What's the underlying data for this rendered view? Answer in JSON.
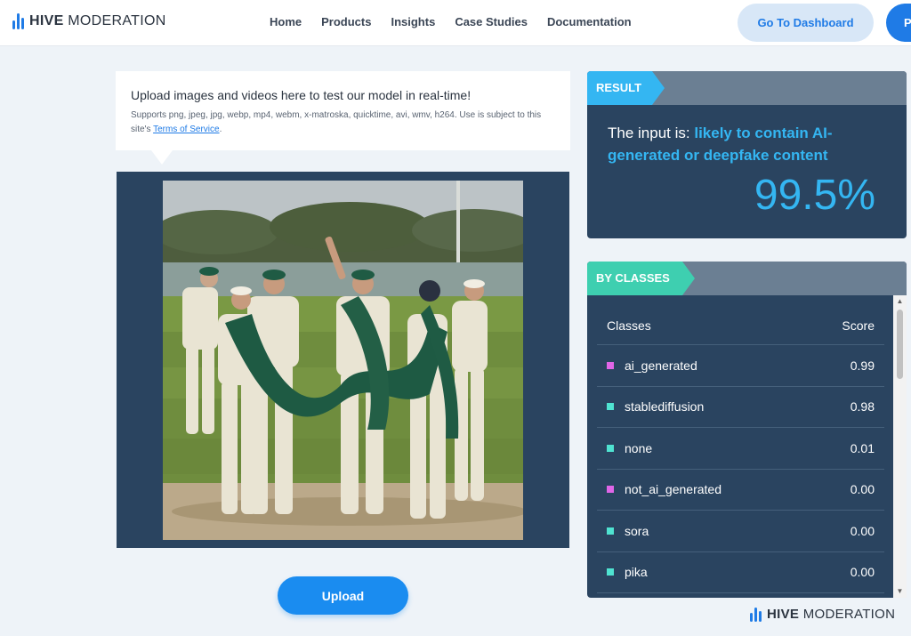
{
  "brand": {
    "bold": "HIVE",
    "light": "MODERATION"
  },
  "nav": [
    "Home",
    "Products",
    "Insights",
    "Case Studies",
    "Documentation"
  ],
  "header_buttons": {
    "dashboard": "Go To Dashboard",
    "cut_button": "P"
  },
  "upload_info": {
    "title": "Upload images and videos here to test our model in real-time!",
    "supports": "Supports png, jpeg, jpg, webp, mp4, webm, x-matroska, quicktime, avi, wmv, h264. Use is subject to this site's",
    "terms_link": "Terms of Service",
    "terms_end": "."
  },
  "upload_button": "Upload",
  "result": {
    "tag": "RESULT",
    "prefix": "The input is:",
    "verdict": "likely to contain AI-generated or deepfake content",
    "percent": "99.5%"
  },
  "classes": {
    "tag": "BY CLASSES",
    "header": {
      "name": "Classes",
      "score": "Score"
    },
    "rows": [
      {
        "name": "ai_generated",
        "score": "0.99",
        "color": "#e066e8"
      },
      {
        "name": "stablediffusion",
        "score": "0.98",
        "color": "#4fe3d1"
      },
      {
        "name": "none",
        "score": "0.01",
        "color": "#4fe3d1"
      },
      {
        "name": "not_ai_generated",
        "score": "0.00",
        "color": "#e066e8"
      },
      {
        "name": "sora",
        "score": "0.00",
        "color": "#4fe3d1"
      },
      {
        "name": "pika",
        "score": "0.00",
        "color": "#4fe3d1"
      }
    ]
  },
  "colors": {
    "accent": "#34b6f2",
    "panel": "#2a4460",
    "primary": "#1f7be6",
    "classes_tag": "#3ecfb0"
  },
  "icons": {
    "logo": "bars-logo-icon"
  }
}
